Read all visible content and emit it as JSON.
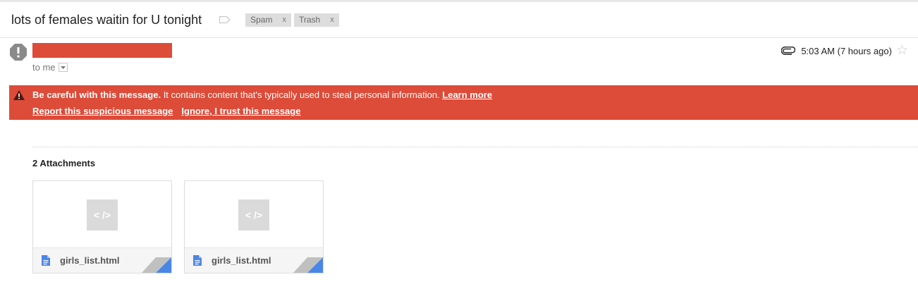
{
  "subject": "lots of females waitin for U tonight",
  "labels": [
    {
      "name": "Spam",
      "remove": "x"
    },
    {
      "name": "Trash",
      "remove": "x"
    }
  ],
  "sender": {
    "to_text": "to me"
  },
  "meta": {
    "time": "5:03 AM (7 hours ago)"
  },
  "warning": {
    "bold": "Be careful with this message.",
    "text": " It contains content that's typically used to steal personal information. ",
    "learn_more": "Learn more",
    "report": "Report this suspicious message",
    "ignore": "Ignore, I trust this message",
    "color": "#dd4b39"
  },
  "attachments": {
    "title": "2 Attachments",
    "thumb_glyph": "< />",
    "items": [
      {
        "file_name": "girls_list.html",
        "icon": "document-icon"
      },
      {
        "file_name": "girls_list.html",
        "icon": "document-icon"
      }
    ]
  }
}
